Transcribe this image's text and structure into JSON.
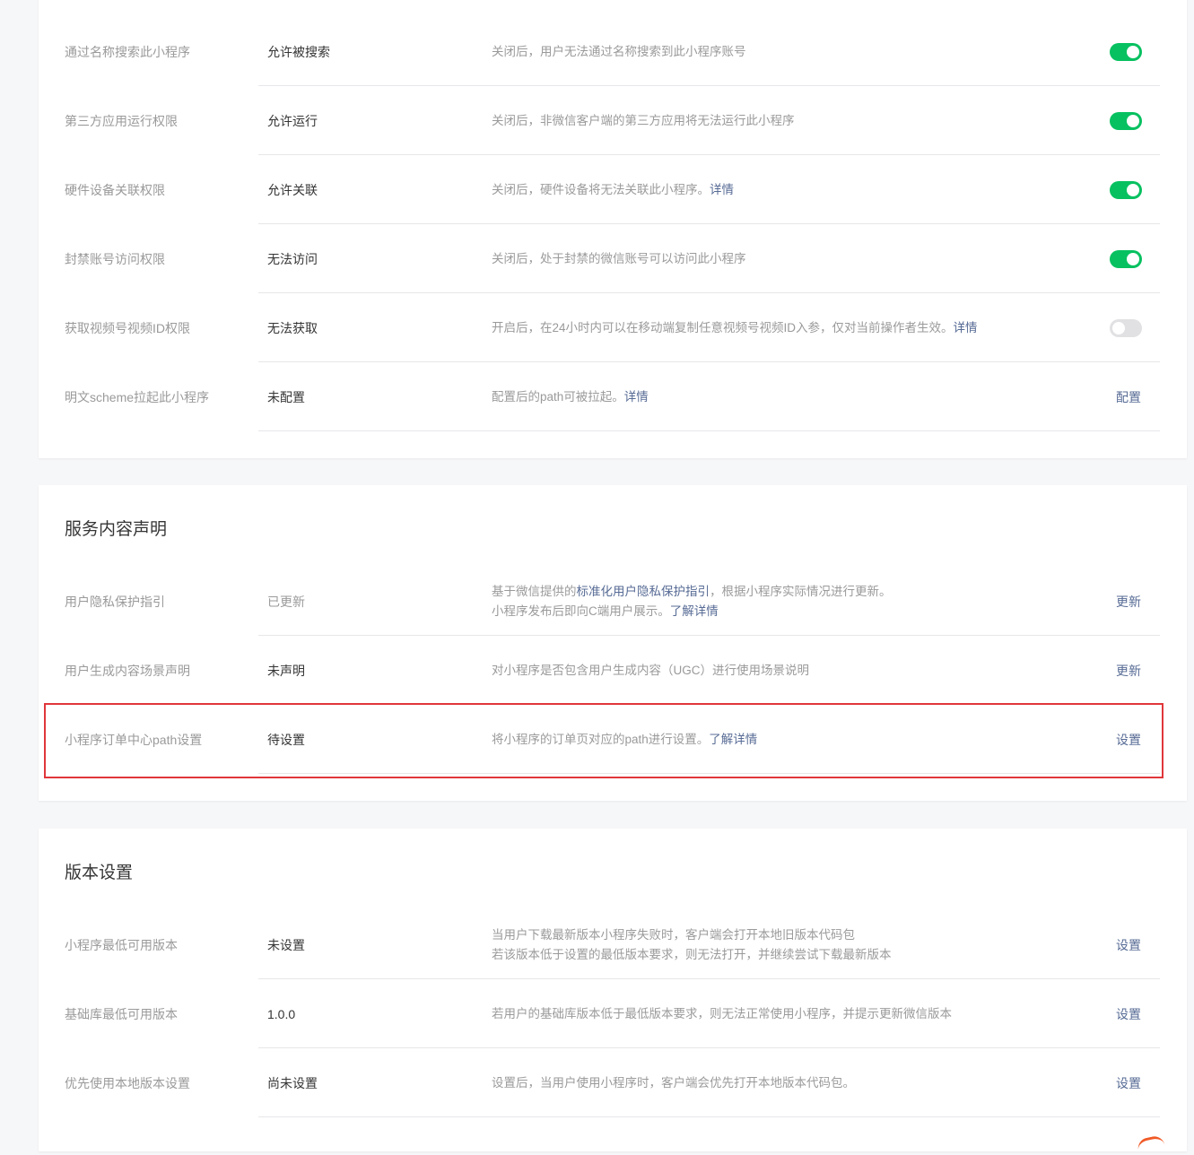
{
  "colors": {
    "toggle_on": "#07c160",
    "toggle_off": "#e1e1e3",
    "link": "#576b95",
    "highlight": "#e0363a"
  },
  "permissions": {
    "rows": [
      {
        "label": "通过名称搜索此小程序",
        "status": "允许被搜索",
        "desc": "关闭后，用户无法通过名称搜索到此小程序账号",
        "desc_link": "",
        "toggle": "on"
      },
      {
        "label": "第三方应用运行权限",
        "status": "允许运行",
        "desc": "关闭后，非微信客户端的第三方应用将无法运行此小程序",
        "desc_link": "",
        "toggle": "on"
      },
      {
        "label": "硬件设备关联权限",
        "status": "允许关联",
        "desc": "关闭后，硬件设备将无法关联此小程序。",
        "desc_link": "详情",
        "toggle": "on"
      },
      {
        "label": "封禁账号访问权限",
        "status": "无法访问",
        "desc": "关闭后，处于封禁的微信账号可以访问此小程序",
        "desc_link": "",
        "toggle": "on"
      },
      {
        "label": "获取视频号视频ID权限",
        "status": "无法获取",
        "desc": "开启后，在24小时内可以在移动端复制任意视频号视频ID入参，仅对当前操作者生效。",
        "desc_link": "详情",
        "toggle": "off"
      },
      {
        "label": "明文scheme拉起此小程序",
        "status": "未配置",
        "desc": "配置后的path可被拉起。",
        "desc_link": "详情",
        "action": "配置"
      }
    ]
  },
  "service": {
    "title": "服务内容声明",
    "privacy": {
      "label": "用户隐私保护指引",
      "status": "已更新",
      "desc_pre": "基于微信提供的",
      "desc_link1": "标准化用户隐私保护指引",
      "desc_mid": "，根据小程序实际情况进行更新。",
      "desc_line2": "小程序发布后即向C端用户展示。",
      "desc_link2": "了解详情",
      "action": "更新"
    },
    "ugc": {
      "label": "用户生成内容场景声明",
      "status": "未声明",
      "desc": "对小程序是否包含用户生成内容（UGC）进行使用场景说明",
      "action": "更新"
    },
    "order_path": {
      "label": "小程序订单中心path设置",
      "status": "待设置",
      "desc": "将小程序的订单页对应的path进行设置。",
      "desc_link": "了解详情",
      "action": "设置"
    }
  },
  "version": {
    "title": "版本设置",
    "min_version": {
      "label": "小程序最低可用版本",
      "status": "未设置",
      "desc_line1": "当用户下载最新版本小程序失败时，客户端会打开本地旧版本代码包",
      "desc_line2": "若该版本低于设置的最低版本要求，则无法打开，并继续尝试下载最新版本",
      "action": "设置"
    },
    "base_lib": {
      "label": "基础库最低可用版本",
      "status": "1.0.0",
      "desc": "若用户的基础库版本低于最低版本要求，则无法正常使用小程序，并提示更新微信版本",
      "action": "设置"
    },
    "local_first": {
      "label": "优先使用本地版本设置",
      "status": "尚未设置",
      "desc": "设置后，当用户使用小程序时，客户端会优先打开本地版本代码包。",
      "action": "设置"
    }
  }
}
